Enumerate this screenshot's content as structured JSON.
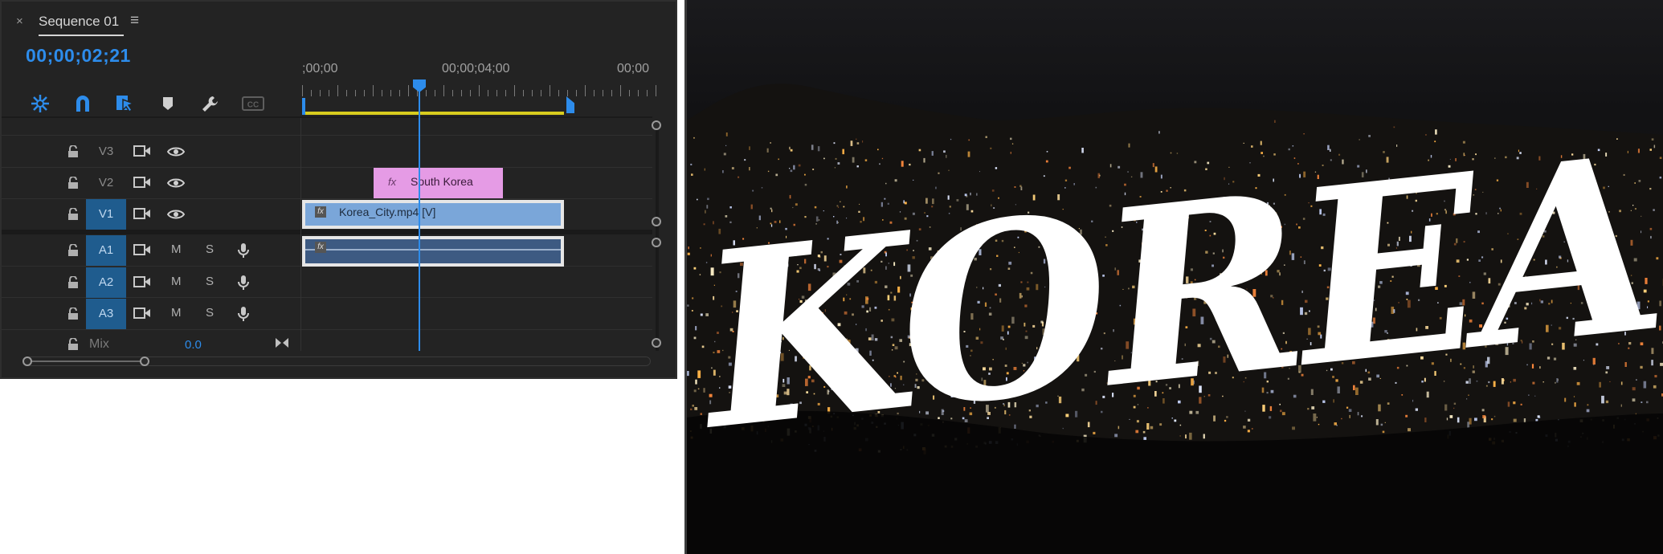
{
  "timeline": {
    "tab": {
      "close_glyph": "×",
      "title": "Sequence 01",
      "menu_glyph": "≡"
    },
    "timecode": "00;00;02;21",
    "tools": [
      "insert-nest-icon",
      "snap-magnet-icon",
      "linked-selection-icon",
      "add-marker-icon",
      "settings-wrench-icon",
      "captions-icon"
    ],
    "ruler": {
      "start_label": ";00;00",
      "mid_label": "00;00;04;00",
      "end_label": "00;00"
    },
    "video_tracks": [
      {
        "name": "V3",
        "active": false
      },
      {
        "name": "V2",
        "active": false
      },
      {
        "name": "V1",
        "active": true
      }
    ],
    "audio_tracks": [
      {
        "name": "A1",
        "mute": "M",
        "solo": "S"
      },
      {
        "name": "A2",
        "mute": "M",
        "solo": "S"
      },
      {
        "name": "A3",
        "mute": "M",
        "solo": "S"
      }
    ],
    "mix": {
      "label": "Mix",
      "value": "0.0"
    },
    "clips": {
      "v2": {
        "fx": "fx",
        "label": "South Korea",
        "color": "#e59be5"
      },
      "v1": {
        "fx": "fx",
        "label": "Korea_City.mp4 [V]",
        "color": "#7aa6d9"
      },
      "a1": {
        "fx": "fx",
        "color": "#3d5a82"
      }
    },
    "colors": {
      "accent": "#2d8ceb",
      "work_area": "#d8cc1e",
      "active_track": "#1f5c8e"
    }
  },
  "preview": {
    "title_text": "KOREA",
    "background": "night-city-skyline-image"
  }
}
